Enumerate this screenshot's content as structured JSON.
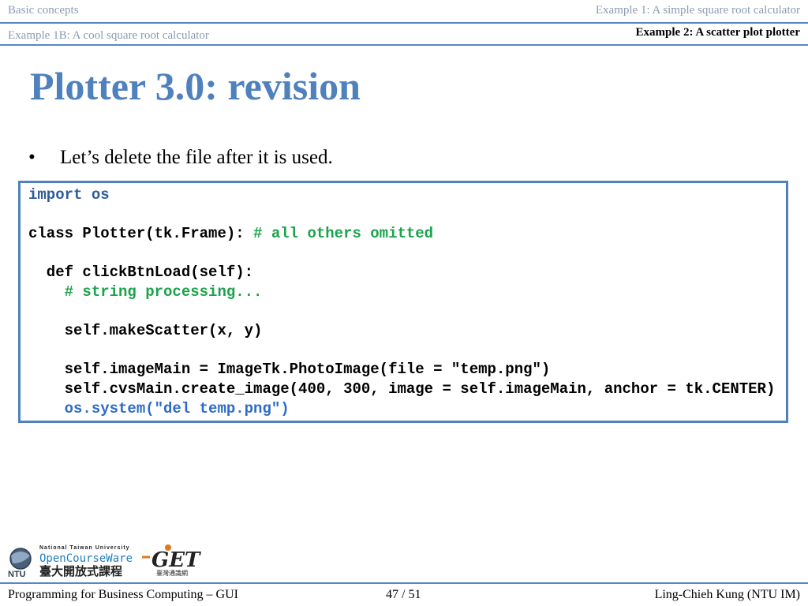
{
  "nav": {
    "section_basic": "Basic concepts",
    "example1": "Example 1: A simple square root calculator",
    "example1b": "Example 1B: A cool square root calculator",
    "example2": "Example 2: A scatter plot plotter"
  },
  "slide": {
    "title": "Plotter 3.0: revision",
    "bullet": "Let’s delete the file after it is used."
  },
  "code": {
    "line1_kw": "import os",
    "line2_code": "class Plotter(tk.Frame): ",
    "line2_comment": "# all others omitted",
    "line3": "  def clickBtnLoad(self):",
    "line4_comment": "    # string processing...",
    "line5": "    self.makeScatter(x, y)",
    "line6": "    self.imageMain = ImageTk.PhotoImage(file = \"temp.png\")",
    "line7": "    self.cvsMain.create_image(400, 300, image = self.imageMain, anchor = tk.CENTER)",
    "line8_sys": "    os.system(\"del temp.png\")"
  },
  "logos": {
    "ntu_caption": "National Taiwan University",
    "ocw": "OpenCourseWare",
    "ocw_cn": "臺大開放式課程",
    "ntu_mark": "NTU",
    "get_mark": "GET",
    "get_cn": "臺灣通識網"
  },
  "footer": {
    "course": "Programming for Business Computing – GUI",
    "page": "47 / 51",
    "author": "Ling-Chieh Kung (NTU IM)"
  },
  "colors": {
    "accent": "#4f81bd",
    "rule": "#5b86c6",
    "comment": "#1aa34a",
    "keyword": "#2e5b9a"
  }
}
